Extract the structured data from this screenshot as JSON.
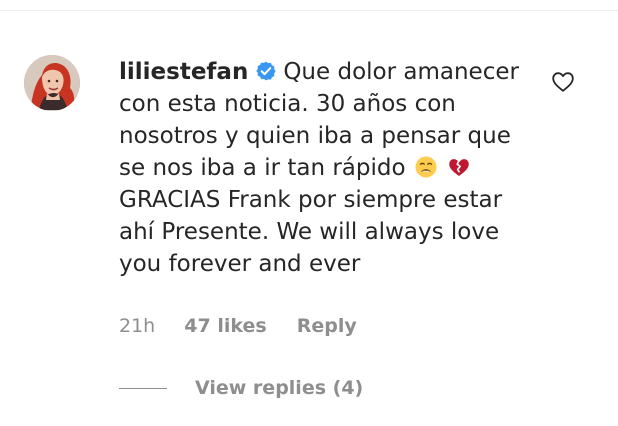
{
  "comment": {
    "username": "liliestefan",
    "text_part1": "Que dolor amanecer con esta noticia. 30 años con nosotros y quien iba a pensar que se nos iba a ir tan rápido",
    "text_part2": "GRACIAS Frank por siempre estar ahí Presente. We will always love you forever and ever",
    "emojis": [
      "weary-face-emoji",
      "broken-heart-emoji"
    ],
    "verified_icon": "verified-badge-icon",
    "like_icon": "heart-outline-icon"
  },
  "meta": {
    "time": "21h",
    "likes": "47 likes",
    "reply": "Reply"
  },
  "replies": {
    "label": "View replies (4)"
  },
  "colors": {
    "text": "#262626",
    "muted": "#8e8e8e",
    "verified": "#3897f0",
    "broken_heart": "#be1931",
    "emoji_yellow": "#ffcc4d"
  }
}
